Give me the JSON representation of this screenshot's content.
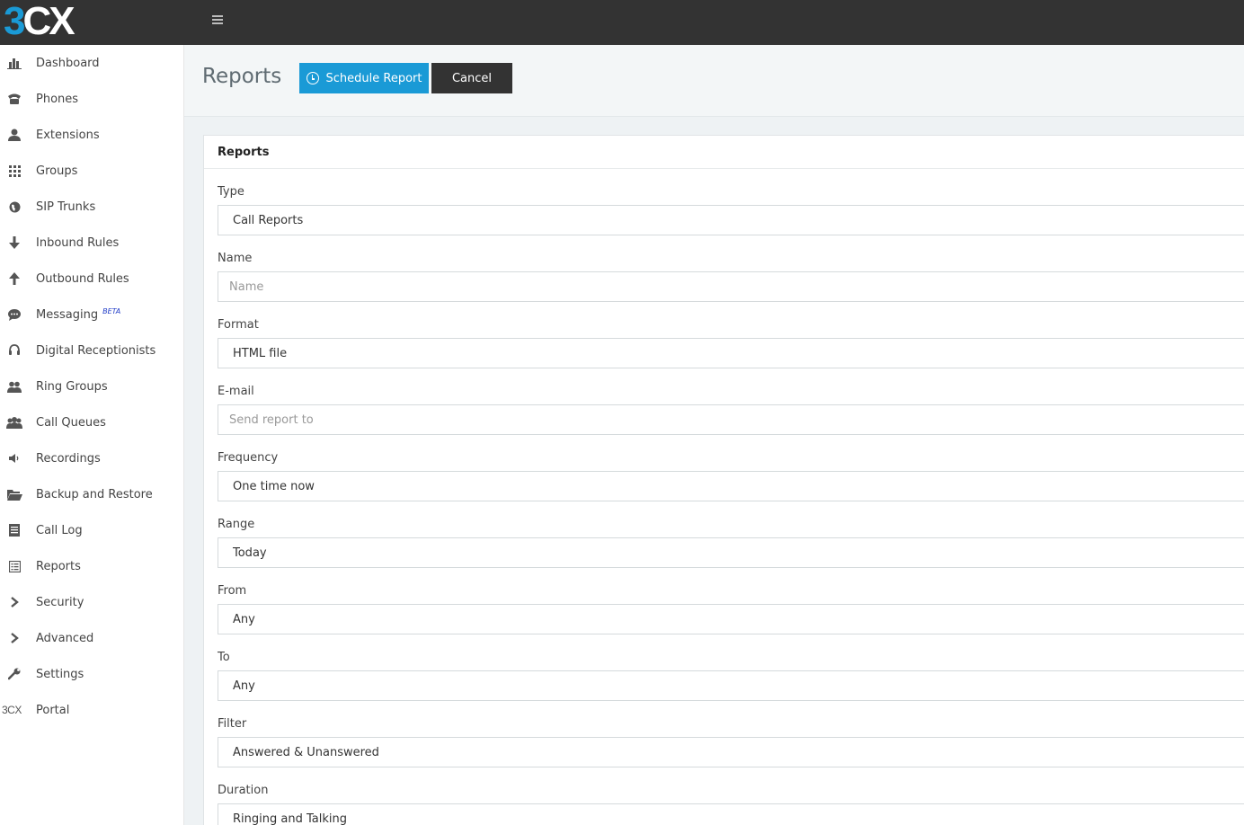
{
  "brand": {
    "logo_3": "3",
    "logo_cx": "CX",
    "accent": "#1a9ad6",
    "topbar_color": "#333333"
  },
  "sidebar": {
    "items": [
      {
        "label": "Dashboard",
        "icon": "bar-chart-icon"
      },
      {
        "label": "Phones",
        "icon": "phone-icon"
      },
      {
        "label": "Extensions",
        "icon": "user-icon"
      },
      {
        "label": "Groups",
        "icon": "grid-icon"
      },
      {
        "label": "SIP Trunks",
        "icon": "globe-icon"
      },
      {
        "label": "Inbound Rules",
        "icon": "arrow-down-icon"
      },
      {
        "label": "Outbound Rules",
        "icon": "arrow-up-icon"
      },
      {
        "label": "Messaging",
        "icon": "chat-icon",
        "badge": "BETA"
      },
      {
        "label": "Digital Receptionists",
        "icon": "headset-icon"
      },
      {
        "label": "Ring Groups",
        "icon": "users-icon"
      },
      {
        "label": "Call Queues",
        "icon": "users-group-icon"
      },
      {
        "label": "Recordings",
        "icon": "volume-icon"
      },
      {
        "label": "Backup and Restore",
        "icon": "folder-open-icon"
      },
      {
        "label": "Call Log",
        "icon": "list-icon"
      },
      {
        "label": "Reports",
        "icon": "report-icon"
      },
      {
        "label": "Security",
        "icon": "chevron-right-icon"
      },
      {
        "label": "Advanced",
        "icon": "chevron-right-icon"
      },
      {
        "label": "Settings",
        "icon": "wrench-icon"
      },
      {
        "label": "Portal",
        "icon": "3cx-icon",
        "icon_text": "3CX"
      }
    ]
  },
  "header": {
    "title": "Reports",
    "schedule_button": "Schedule Report",
    "cancel_button": "Cancel"
  },
  "panel": {
    "title": "Reports",
    "fields": [
      {
        "label": "Type",
        "value": "Call Reports",
        "kind": "select"
      },
      {
        "label": "Name",
        "placeholder": "Name",
        "kind": "input"
      },
      {
        "label": "Format",
        "value": "HTML file",
        "kind": "select"
      },
      {
        "label": "E-mail",
        "placeholder": "Send report to",
        "kind": "input"
      },
      {
        "label": "Frequency",
        "value": "One time now",
        "kind": "select"
      },
      {
        "label": "Range",
        "value": "Today",
        "kind": "select"
      },
      {
        "label": "From",
        "value": "Any",
        "kind": "select"
      },
      {
        "label": "To",
        "value": "Any",
        "kind": "select"
      },
      {
        "label": "Filter",
        "value": "Answered & Unanswered",
        "kind": "select"
      },
      {
        "label": "Duration",
        "value": "Ringing and Talking",
        "kind": "select"
      }
    ]
  }
}
